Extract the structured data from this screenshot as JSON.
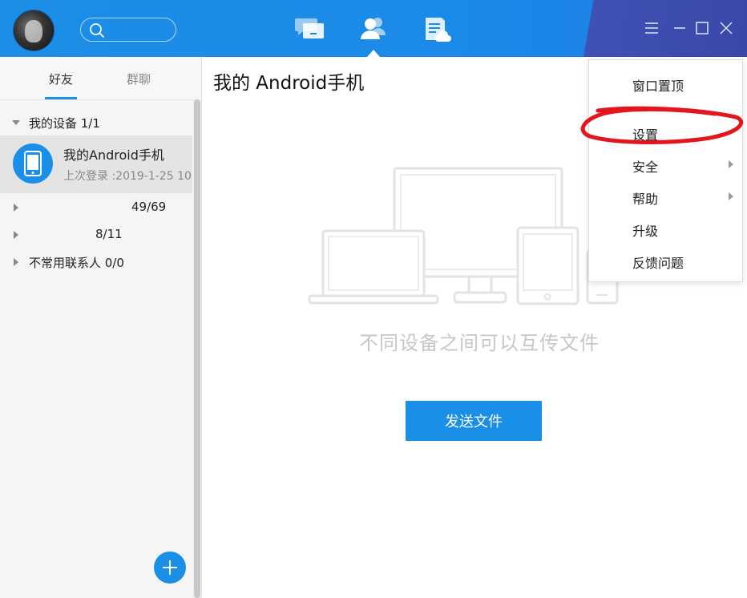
{
  "titlebar": {
    "nav": [
      "chat-icon",
      "contacts-icon",
      "notes-icon"
    ],
    "active_nav": "contacts-icon",
    "window_controls": [
      "menu-icon",
      "minimize-icon",
      "maximize-icon",
      "close-icon"
    ]
  },
  "sidebar": {
    "tabs": [
      {
        "label": "好友",
        "active": true
      },
      {
        "label": "群聊",
        "active": false
      }
    ],
    "groups": [
      {
        "label": "我的设备 1/1",
        "expanded": true
      },
      {
        "label": "49/69",
        "expanded": false
      },
      {
        "label": "8/11",
        "expanded": false
      },
      {
        "label": "不常用联系人 0/0",
        "expanded": false
      }
    ],
    "device": {
      "name": "我的Android手机",
      "last_login": "上次登录 :2019-1-25 10"
    }
  },
  "main": {
    "title": "我的 Android手机",
    "hint": "不同设备之间可以互传文件",
    "send_button": "发送文件"
  },
  "menu": {
    "items": [
      {
        "label": "窗口置顶",
        "has_submenu": false
      },
      {
        "label": "设置",
        "has_submenu": false
      },
      {
        "label": "安全",
        "has_submenu": true
      },
      {
        "label": "帮助",
        "has_submenu": true
      },
      {
        "label": "升级",
        "has_submenu": false
      },
      {
        "label": "反馈问题",
        "has_submenu": false
      }
    ],
    "highlighted": "设置"
  },
  "colors": {
    "accent": "#1a8fe8",
    "titlebar_corner": "#3f51b5",
    "annotation": "#e3161d"
  }
}
